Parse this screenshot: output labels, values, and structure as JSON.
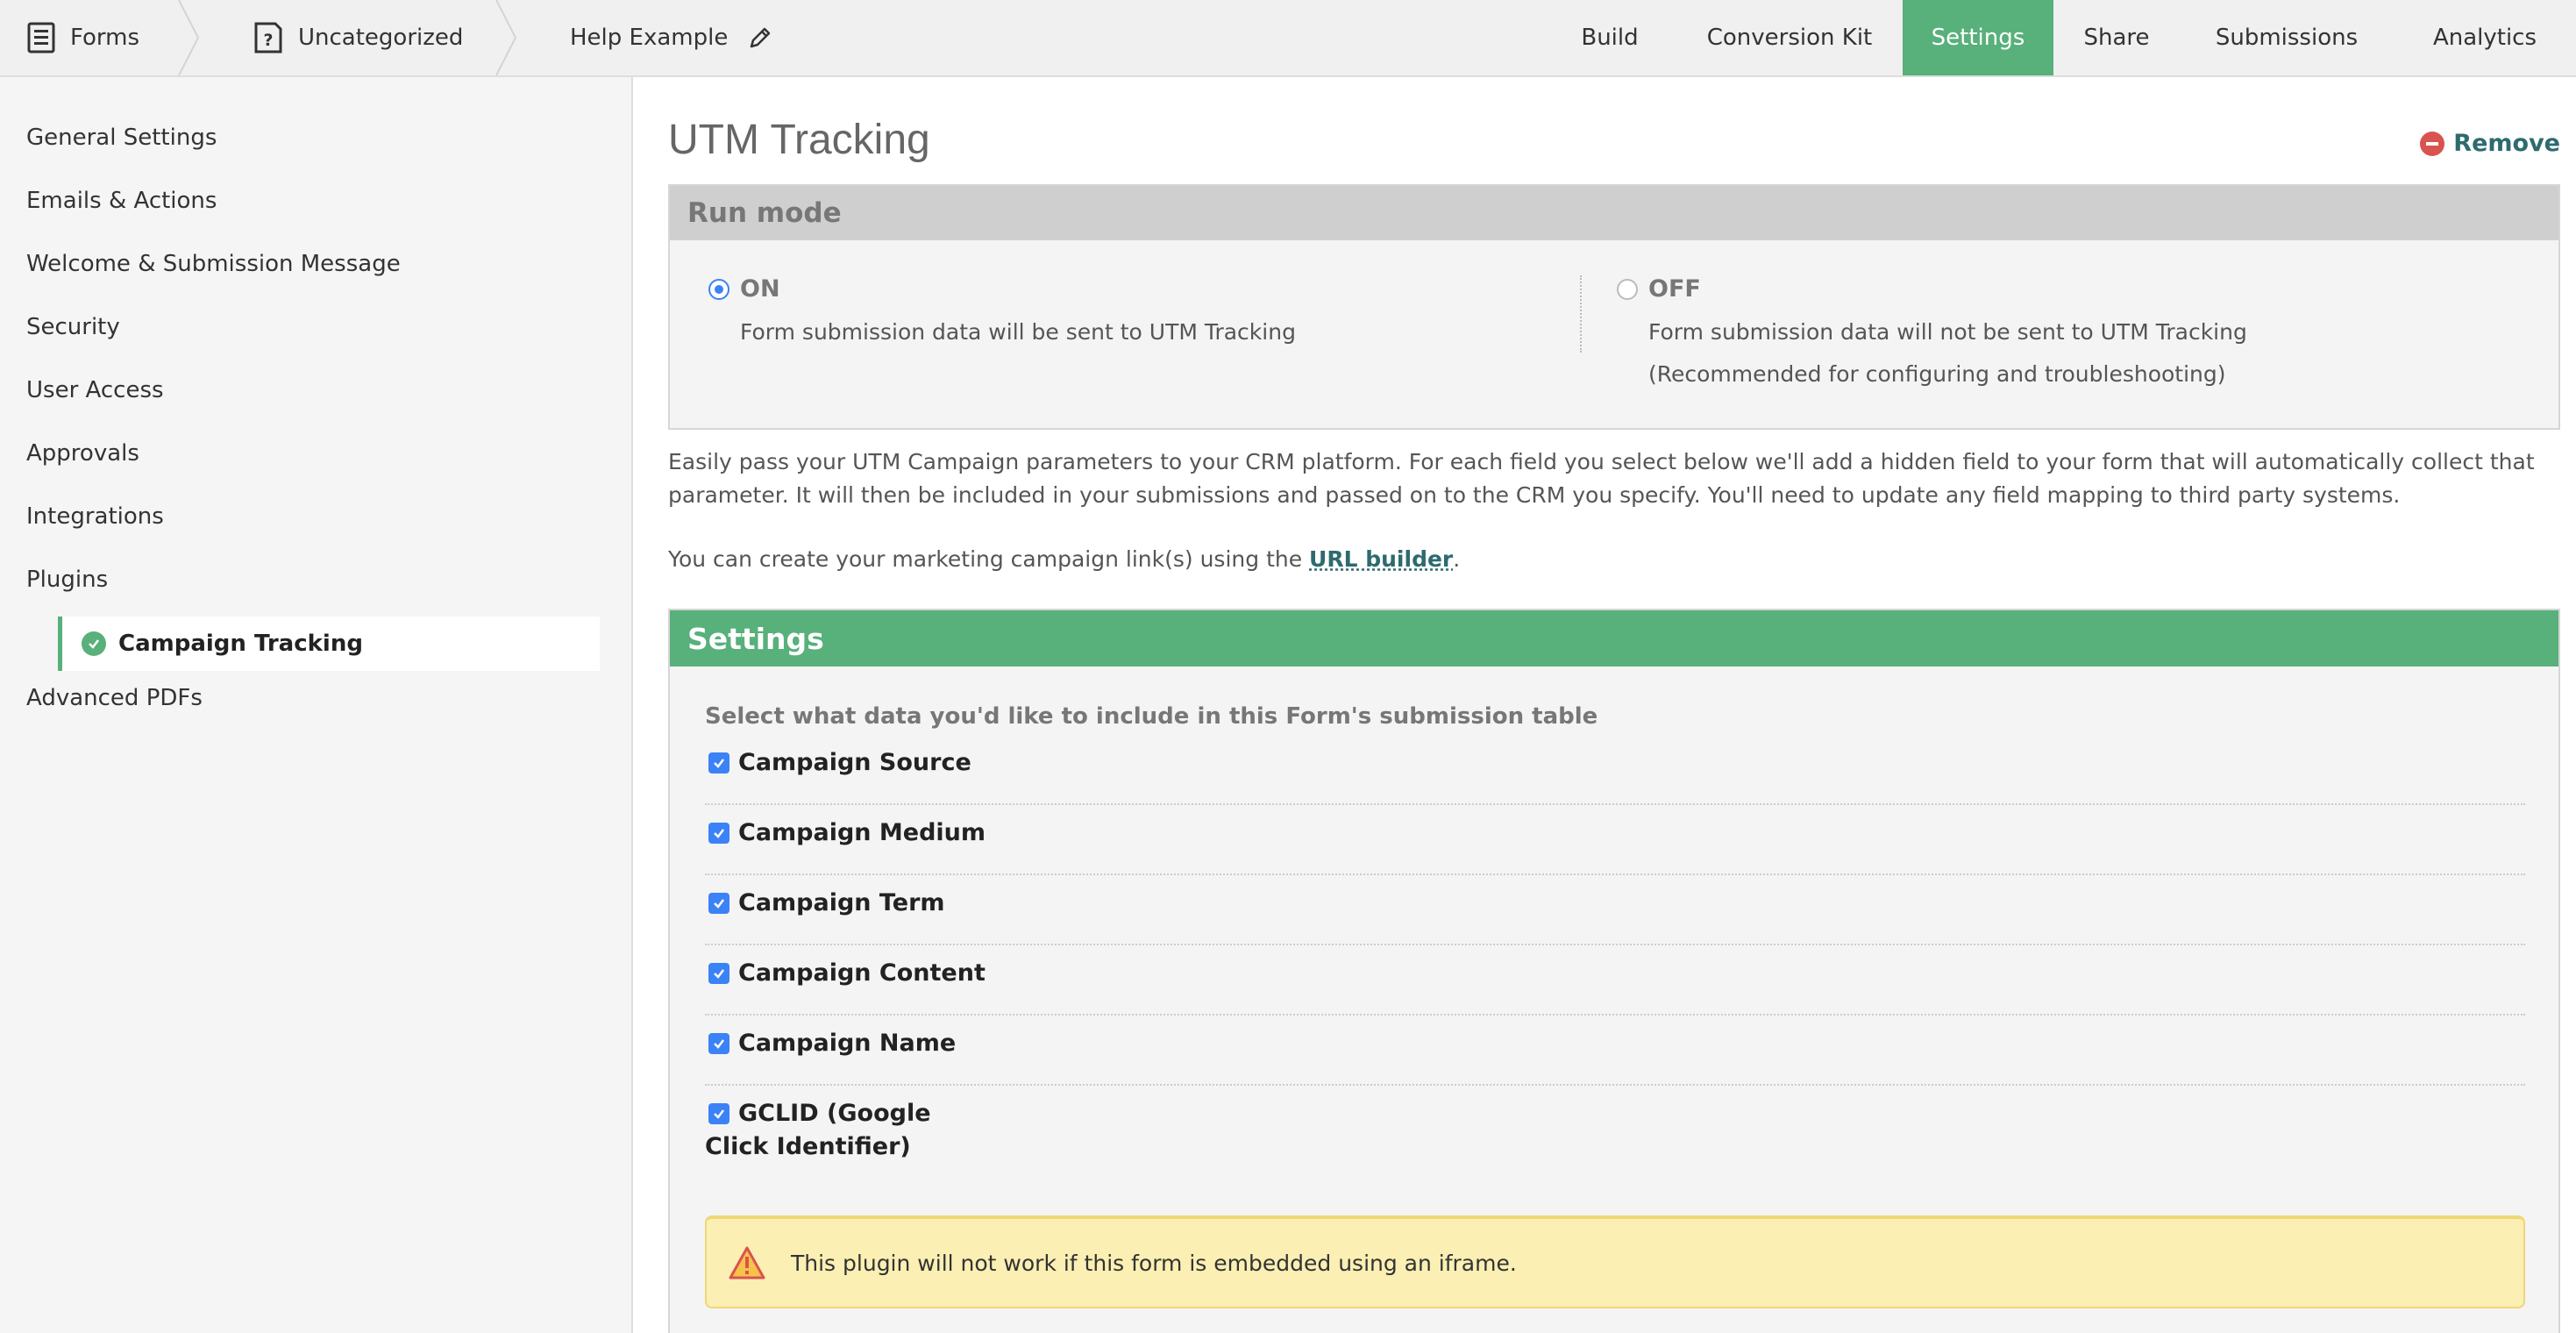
{
  "breadcrumb": {
    "forms": "Forms",
    "category": "Uncategorized",
    "form_name": "Help Example"
  },
  "topnav": {
    "build": "Build",
    "conversion_kit": "Conversion Kit",
    "settings": "Settings",
    "share": "Share",
    "submissions": "Submissions",
    "analytics": "Analytics"
  },
  "sidebar": {
    "items": [
      "General Settings",
      "Emails & Actions",
      "Welcome & Submission Message",
      "Security",
      "User Access",
      "Approvals",
      "Integrations",
      "Plugins",
      "Advanced PDFs"
    ],
    "active_sub": "Campaign Tracking"
  },
  "main": {
    "title": "UTM Tracking",
    "remove": "Remove",
    "run_mode": {
      "heading": "Run mode",
      "on_label": "ON",
      "on_desc": "Form submission data will be sent to UTM Tracking",
      "off_label": "OFF",
      "off_desc_1": "Form submission data will not be sent to UTM Tracking",
      "off_desc_2": "(Recommended for configuring and troubleshooting)"
    },
    "description": "Easily pass your UTM Campaign parameters to your CRM platform. For each field you select below we'll add a hidden field to your form that will automatically collect that parameter. It will then be included in your submissions and passed on to the CRM you specify. You'll need to update any field mapping to third party systems.",
    "link_prefix": "You can create your marketing campaign link(s) using the ",
    "link_text": "URL builder",
    "link_suffix": ".",
    "settings": {
      "heading": "Settings",
      "subheading": "Select what data you'd like to include in this Form's submission table",
      "options": [
        "Campaign Source",
        "Campaign Medium",
        "Campaign Term",
        "Campaign Content",
        "Campaign Name"
      ],
      "gclid_line1": "GCLID (Google",
      "gclid_line2": "Click Identifier)",
      "warning": "This plugin will not work if this form is embedded using an iframe."
    }
  },
  "colors": {
    "accent_green": "#58b07b",
    "link_teal": "#2d6b6f",
    "checkbox_blue": "#3b82f6",
    "warning_bg": "#fbefb3"
  }
}
